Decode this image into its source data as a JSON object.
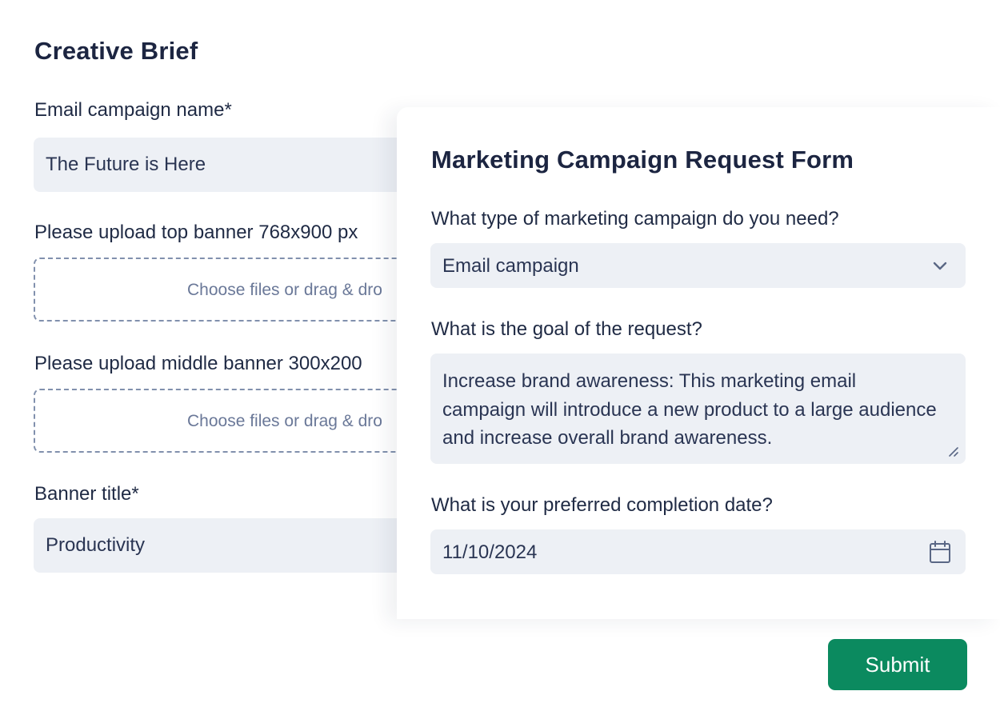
{
  "brief": {
    "title": "Creative Brief",
    "campaign_name": {
      "label": "Email campaign name*",
      "value": "The Future is Here"
    },
    "top_banner": {
      "label": "Please upload top banner 768x900 px",
      "placeholder": "Choose files or drag & dro"
    },
    "middle_banner": {
      "label": "Please upload middle banner 300x200",
      "placeholder": "Choose files or drag & dro"
    },
    "banner_title": {
      "label": "Banner title*",
      "value": "Productivity"
    }
  },
  "request": {
    "title": "Marketing Campaign Request Form",
    "campaign_type": {
      "label": "What type of marketing campaign do you need?",
      "value": "Email campaign",
      "icon": "chevron-down-icon"
    },
    "goal": {
      "label": "What is the goal of the request?",
      "value": "Increase brand awareness: This marketing email campaign will introduce a new product to a large audience and increase overall brand awareness."
    },
    "completion_date": {
      "label": "What is your preferred completion date?",
      "value": "11/10/2024",
      "icon": "calendar-icon"
    }
  },
  "submit_label": "Submit",
  "colors": {
    "accent": "#0b8a5f",
    "field_bg": "#edf0f5",
    "heading": "#1c2541",
    "placeholder": "#6a7898"
  }
}
